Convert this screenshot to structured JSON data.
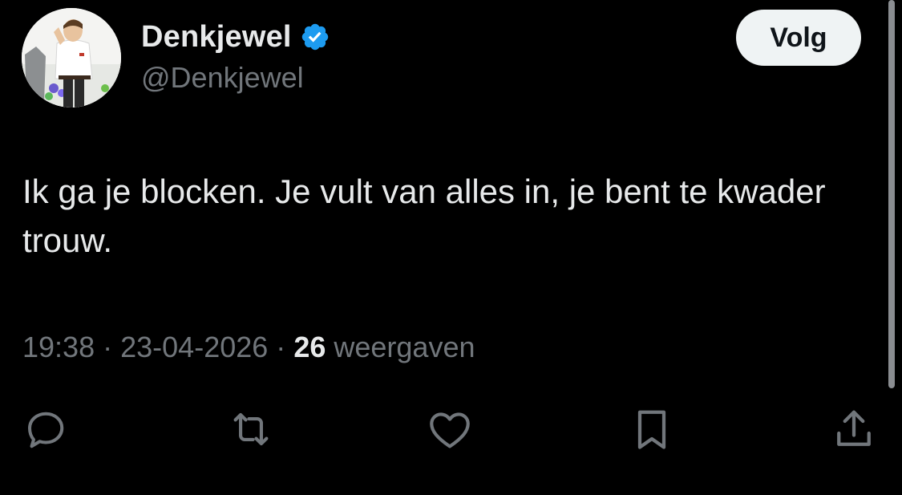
{
  "author": {
    "display_name": "Denkjewel",
    "handle": "@Denkjewel",
    "verified_icon": "verified-badge-icon",
    "verified_color": "#1d9bf0"
  },
  "follow_button": {
    "label": "Volg"
  },
  "tweet": {
    "text": "Ik ga je blocken. Je vult van alles in, je bent te kwader trouw."
  },
  "meta": {
    "time": "19:38",
    "separator": "·",
    "date": "23-04-2026",
    "views_count": "26",
    "views_label": "weergaven"
  },
  "actions": [
    {
      "name": "reply-icon"
    },
    {
      "name": "retweet-icon"
    },
    {
      "name": "like-icon"
    },
    {
      "name": "bookmark-icon"
    },
    {
      "name": "share-icon"
    }
  ],
  "colors": {
    "background": "#000000",
    "text_primary": "#e7e9ea",
    "text_secondary": "#71767b",
    "accent": "#1d9bf0"
  }
}
